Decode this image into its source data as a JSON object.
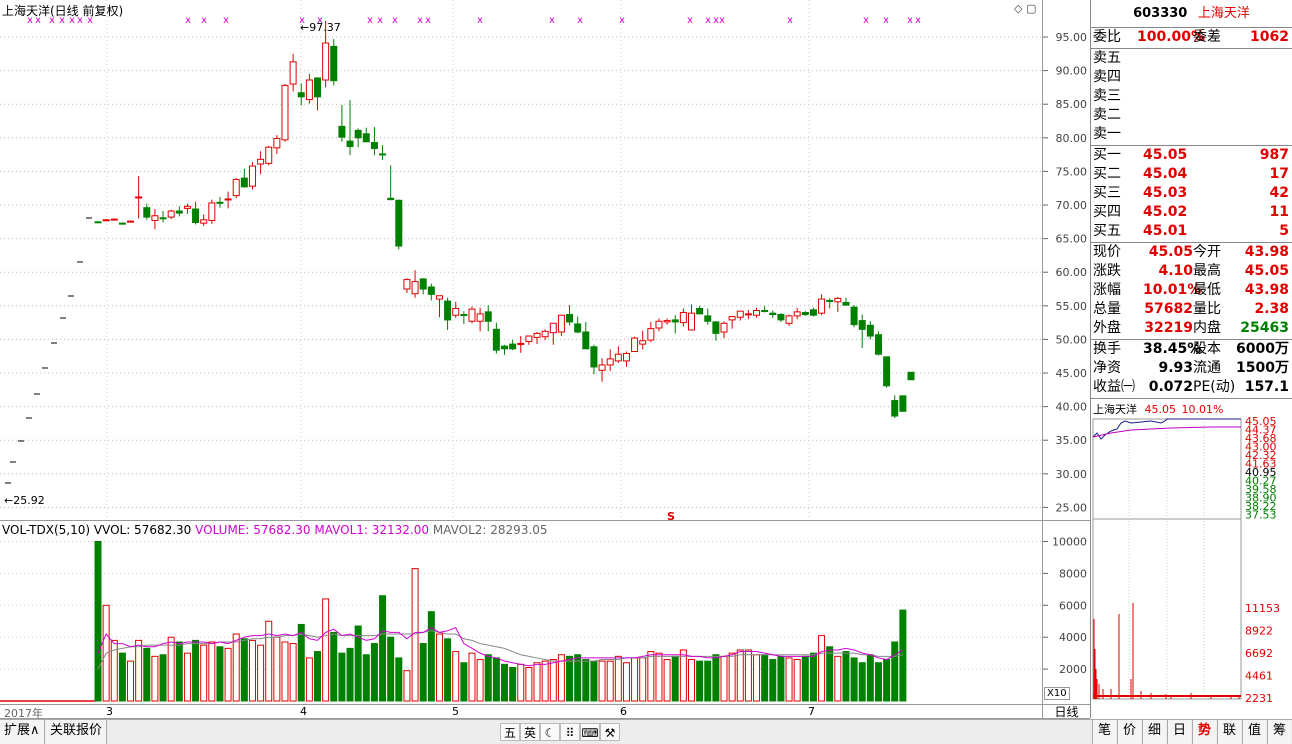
{
  "kline": {
    "title": "上海天洋(日线 前复权)",
    "high_label": "97.37",
    "low_label": "25.92",
    "s_marker": "S",
    "y_ticks": [
      "95.00",
      "90.00",
      "85.00",
      "80.00",
      "75.00",
      "70.00",
      "65.00",
      "60.00",
      "55.00",
      "50.00",
      "45.00",
      "40.00",
      "35.00",
      "30.00",
      "25.00"
    ],
    "y_values": [
      95,
      90,
      85,
      80,
      75,
      70,
      65,
      60,
      55,
      50,
      45,
      40,
      35,
      30,
      25
    ],
    "candles": [
      [
        67.5,
        67.6,
        67.3,
        67.4
      ],
      [
        67.8,
        67.9,
        67.7,
        67.8
      ],
      [
        67.9,
        68.0,
        67.8,
        67.9
      ],
      [
        67.3,
        67.4,
        67.1,
        67.2
      ],
      [
        67.6,
        67.7,
        67.5,
        67.6
      ],
      [
        71.2,
        74.3,
        68.0,
        71.2
      ],
      [
        69.6,
        70.2,
        67.8,
        68.2
      ],
      [
        67.7,
        69.4,
        66.4,
        68.4
      ],
      [
        68.1,
        69.1,
        67.4,
        68.0
      ],
      [
        68.2,
        69.3,
        67.9,
        69.1
      ],
      [
        69.1,
        69.8,
        68.3,
        68.8
      ],
      [
        69.5,
        70.2,
        68.7,
        69.8
      ],
      [
        69.4,
        70.5,
        67.1,
        67.4
      ],
      [
        67.3,
        68.6,
        66.9,
        67.8
      ],
      [
        67.7,
        70.8,
        67.2,
        70.3
      ],
      [
        70.4,
        71.2,
        69.6,
        70.3
      ],
      [
        70.8,
        72.0,
        69.5,
        70.9
      ],
      [
        71.4,
        74.0,
        71.0,
        73.8
      ],
      [
        74.0,
        75.4,
        72.6,
        72.7
      ],
      [
        72.8,
        76.4,
        72.3,
        75.8
      ],
      [
        76.1,
        78.0,
        74.6,
        76.8
      ],
      [
        76.2,
        78.8,
        75.9,
        78.6
      ],
      [
        78.5,
        80.4,
        77.6,
        79.9
      ],
      [
        79.7,
        88.0,
        79.4,
        87.8
      ],
      [
        88.0,
        92.5,
        86.9,
        91.3
      ],
      [
        86.7,
        88.1,
        84.8,
        86.1
      ],
      [
        85.7,
        89.5,
        85.1,
        88.6
      ],
      [
        88.9,
        89.0,
        84.1,
        86.1
      ],
      [
        88.6,
        97.4,
        87.5,
        94.1
      ],
      [
        93.6,
        94.7,
        87.8,
        88.5
      ],
      [
        81.7,
        84.9,
        79.4,
        80.1
      ],
      [
        79.5,
        85.6,
        77.4,
        78.7
      ],
      [
        81.1,
        81.4,
        78.6,
        80.0
      ],
      [
        80.6,
        81.5,
        79.4,
        79.4
      ],
      [
        79.3,
        81.6,
        77.4,
        78.4
      ],
      [
        77.6,
        78.9,
        76.7,
        77.5
      ],
      [
        71.0,
        75.9,
        70.7,
        70.8
      ],
      [
        70.7,
        70.8,
        63.4,
        63.9
      ],
      [
        57.5,
        59.1,
        56.9,
        58.9
      ],
      [
        56.8,
        60.3,
        56.2,
        58.6
      ],
      [
        59.0,
        59.1,
        56.7,
        57.5
      ],
      [
        57.8,
        58.3,
        55.8,
        56.7
      ],
      [
        56.0,
        56.5,
        53.3,
        56.5
      ],
      [
        55.7,
        56.2,
        51.4,
        52.9
      ],
      [
        53.6,
        55.6,
        53.2,
        54.6
      ],
      [
        53.7,
        54.2,
        52.3,
        53.6
      ],
      [
        52.7,
        54.9,
        52.4,
        54.5
      ],
      [
        52.7,
        54.7,
        51.2,
        53.8
      ],
      [
        54.1,
        55.1,
        51.2,
        52.7
      ],
      [
        51.5,
        52.5,
        47.9,
        48.4
      ],
      [
        49.0,
        49.2,
        47.7,
        48.6
      ],
      [
        49.3,
        49.9,
        48.4,
        48.6
      ],
      [
        49.3,
        50.5,
        48.0,
        49.4
      ],
      [
        49.7,
        50.6,
        49.2,
        50.5
      ],
      [
        50.3,
        51.1,
        49.3,
        50.9
      ],
      [
        50.4,
        51.5,
        49.9,
        51.2
      ],
      [
        51.0,
        51.4,
        49.2,
        52.4
      ],
      [
        51.1,
        53.6,
        50.5,
        53.6
      ],
      [
        53.7,
        55.1,
        52.1,
        52.6
      ],
      [
        52.3,
        53.4,
        50.9,
        51.1
      ],
      [
        51.1,
        52.6,
        48.6,
        48.6
      ],
      [
        48.9,
        49.2,
        44.8,
        45.9
      ],
      [
        45.4,
        47.2,
        43.7,
        46.2
      ],
      [
        46.2,
        48.5,
        45.3,
        47.1
      ],
      [
        46.8,
        49.0,
        46.5,
        47.8
      ],
      [
        46.8,
        48.2,
        45.9,
        47.9
      ],
      [
        48.2,
        50.4,
        48.1,
        50.2
      ],
      [
        49.3,
        51.3,
        48.5,
        49.8
      ],
      [
        49.9,
        52.6,
        49.6,
        51.6
      ],
      [
        51.7,
        53.1,
        51.2,
        52.7
      ],
      [
        52.6,
        53.1,
        52.2,
        52.8
      ],
      [
        52.9,
        53.6,
        50.9,
        52.6
      ],
      [
        52.5,
        54.6,
        51.9,
        54.0
      ],
      [
        51.4,
        55.2,
        51.4,
        53.9
      ],
      [
        54.6,
        55.0,
        53.8,
        53.8
      ],
      [
        53.5,
        54.6,
        52.2,
        52.7
      ],
      [
        52.6,
        52.7,
        49.8,
        50.9
      ],
      [
        51.1,
        52.7,
        50.2,
        52.4
      ],
      [
        52.9,
        53.5,
        51.6,
        53.4
      ],
      [
        53.3,
        54.3,
        52.8,
        54.2
      ],
      [
        53.7,
        54.4,
        53.0,
        53.8
      ],
      [
        53.6,
        54.7,
        53.2,
        54.3
      ],
      [
        54.3,
        55.0,
        54.0,
        54.2
      ],
      [
        53.9,
        54.3,
        53.2,
        53.7
      ],
      [
        53.7,
        53.9,
        52.6,
        52.9
      ],
      [
        52.4,
        53.7,
        52.0,
        53.5
      ],
      [
        53.5,
        54.7,
        53.0,
        54.1
      ],
      [
        54.0,
        54.2,
        53.5,
        53.7
      ],
      [
        54.4,
        54.7,
        53.4,
        53.6
      ],
      [
        53.9,
        56.7,
        53.6,
        56.0
      ],
      [
        55.8,
        56.1,
        54.6,
        55.7
      ],
      [
        55.6,
        56.3,
        54.1,
        56.1
      ],
      [
        55.5,
        56.2,
        55.0,
        55.1
      ],
      [
        54.8,
        55.1,
        51.8,
        52.2
      ],
      [
        52.8,
        53.7,
        48.7,
        51.5
      ],
      [
        52.1,
        52.7,
        50.0,
        50.5
      ],
      [
        50.7,
        51.2,
        47.6,
        47.8
      ],
      [
        47.4,
        47.4,
        42.8,
        43.1
      ],
      [
        40.9,
        41.7,
        38.3,
        38.6
      ],
      [
        41.6,
        41.6,
        39.3,
        39.3
      ],
      [
        45.1,
        45.1,
        44.0,
        44.0
      ]
    ],
    "limit_marks": [
      "x",
      "x",
      "x",
      "x",
      "x",
      "x",
      "x",
      "x",
      "x",
      "x",
      "x",
      "x",
      "x",
      "x",
      "x",
      "x",
      "x",
      "x",
      "x",
      "x",
      "x",
      "x",
      "x",
      "x",
      "x",
      "x",
      "x",
      "x"
    ]
  },
  "volume": {
    "title": "VOL-TDX(5,10)",
    "vol_label": "VVOL: 57682.30",
    "volume_label": "VOLUME: 57682.30",
    "mavol1_label": "MAVOL1: 32132.00",
    "mavol2_label": "MAVOL2: 28293.05",
    "y_ticks": [
      "10000",
      "8000",
      "6000",
      "4000",
      "2000"
    ],
    "y_values": [
      10000,
      8000,
      6000,
      4000,
      2000
    ],
    "scale_mark": "X10",
    "bars": [
      10000,
      6000,
      3800,
      3000,
      2500,
      3800,
      3300,
      2800,
      2900,
      4000,
      3700,
      3000,
      3800,
      3500,
      3700,
      3400,
      3300,
      4200,
      3900,
      3800,
      3500,
      5000,
      4000,
      3700,
      3600,
      4800,
      2700,
      3100,
      6400,
      4300,
      3000,
      3300,
      4700,
      2900,
      3600,
      6600,
      4000,
      2700,
      1900,
      8300,
      3600,
      5600,
      4200,
      3900,
      3100,
      2400,
      3000,
      2600,
      2900,
      2700,
      2300,
      2100,
      2300,
      2100,
      2400,
      2500,
      2600,
      2900,
      2800,
      2900,
      2600,
      2500,
      2500,
      2500,
      2800,
      2400,
      2700,
      2700,
      3100,
      3000,
      2600,
      2800,
      3200,
      2600,
      2500,
      2500,
      2900,
      2800,
      3000,
      3200,
      3200,
      2900,
      2900,
      2600,
      2800,
      2700,
      2600,
      2800,
      3000,
      4100,
      3400,
      2800,
      3100,
      2700,
      2400,
      2900,
      2400,
      2600,
      3700,
      5700
    ],
    "mavol1": [
      3000,
      4200,
      3600,
      3600,
      3400,
      3500,
      3400,
      3400,
      3600,
      3700,
      3600,
      3700,
      3700,
      3700,
      3600,
      3700,
      3600,
      3800,
      4000,
      4100,
      4100,
      4200,
      4100,
      4200,
      4100,
      4300,
      3900,
      3800,
      4300,
      4500,
      4100,
      4200,
      4000,
      3800,
      3900,
      4400,
      4300,
      4300,
      3900,
      4300,
      4300,
      4600,
      4300,
      4400,
      4600,
      3600,
      3300,
      3000,
      2800,
      2700,
      2500,
      2400,
      2300,
      2200,
      2300,
      2300,
      2400,
      2500,
      2600,
      2700,
      2700,
      2700,
      2700,
      2700,
      2700,
      2700,
      2700,
      2800,
      2900,
      2900,
      2900,
      2900,
      2900,
      2800,
      2800,
      2700,
      2700,
      2800,
      2900,
      3100,
      3100,
      3100,
      3000,
      2900,
      2800,
      2800,
      2800,
      2800,
      2800,
      3100,
      3200,
      3200,
      3300,
      3200,
      3000,
      2900,
      2700,
      2600,
      2900,
      3200
    ],
    "mavol2": [
      2000,
      3000,
      3200,
      3300,
      3400,
      3400,
      3500,
      3500,
      3500,
      3500,
      3500,
      3600,
      3600,
      3600,
      3600,
      3700,
      3700,
      3700,
      3800,
      3900,
      3900,
      4000,
      4000,
      4100,
      4100,
      4200,
      4100,
      4000,
      4100,
      4200,
      4100,
      4100,
      4100,
      4100,
      4100,
      4200,
      4200,
      4200,
      4200,
      4200,
      4300,
      4400,
      4300,
      4200,
      4200,
      3900,
      3800,
      3600,
      3500,
      3400,
      3300,
      3100,
      2900,
      2800,
      2700,
      2600,
      2500,
      2500,
      2500,
      2500,
      2500,
      2500,
      2600,
      2600,
      2600,
      2700,
      2700,
      2700,
      2800,
      2800,
      2800,
      2800,
      2800,
      2800,
      2800,
      2800,
      2800,
      2800,
      2800,
      2900,
      2900,
      2900,
      2900,
      2900,
      2900,
      2900,
      2900,
      2900,
      2900,
      3000,
      3000,
      3000,
      3000,
      3000,
      2900,
      2900,
      2800,
      2800,
      2800,
      2900
    ]
  },
  "xaxis": {
    "labels": [
      "2017年",
      "3",
      "4",
      "5",
      "6",
      "7"
    ],
    "right_label": "日线"
  },
  "quote": {
    "code": "603330",
    "name": "上海天洋",
    "weibi_label": "委比",
    "weibi_value": "100.00%",
    "weicha_label": "委差",
    "weicha_value": "1062",
    "sell": [
      {
        "label": "卖五"
      },
      {
        "label": "卖四"
      },
      {
        "label": "卖三"
      },
      {
        "label": "卖二"
      },
      {
        "label": "卖一"
      }
    ],
    "buy": [
      {
        "label": "买一",
        "price": "45.05",
        "vol": "987"
      },
      {
        "label": "买二",
        "price": "45.04",
        "vol": "17"
      },
      {
        "label": "买三",
        "price": "45.03",
        "vol": "42"
      },
      {
        "label": "买四",
        "price": "45.02",
        "vol": "11"
      },
      {
        "label": "买五",
        "price": "45.01",
        "vol": "5"
      }
    ],
    "stats1": [
      {
        "l1": "现价",
        "v1": "45.05",
        "l2": "今开",
        "v2": "43.98"
      },
      {
        "l1": "涨跌",
        "v1": "4.10",
        "l2": "最高",
        "v2": "45.05"
      },
      {
        "l1": "涨幅",
        "v1": "10.01%",
        "l2": "最低",
        "v2": "43.98"
      },
      {
        "l1": "总量",
        "v1": "57682",
        "l2": "量比",
        "v2": "2.38"
      },
      {
        "l1": "外盘",
        "v1": "32219",
        "l2": "内盘",
        "v2": "25463"
      }
    ],
    "stats2": [
      {
        "l1": "换手",
        "v1": "38.45%",
        "l2": "股本",
        "v2": "6000万"
      },
      {
        "l1": "净资",
        "v1": "9.93",
        "l2": "流通",
        "v2": "1500万"
      },
      {
        "l1": "收益㈠",
        "v1": "0.072",
        "l2": "PE(动)",
        "v2": "157.1"
      }
    ]
  },
  "mini": {
    "name": "上海天洋",
    "price": "45.05",
    "pct": "10.01%",
    "price_ticks": [
      "45.05",
      "44.37",
      "43.68",
      "43.00",
      "42.32",
      "41.63",
      "40.95",
      "40.27",
      "39.58",
      "38.90",
      "38.22",
      "37.53"
    ],
    "vol_ticks": [
      "11153",
      "8922",
      "6692",
      "4461",
      "2231"
    ]
  },
  "bottom": {
    "tab1": "扩展∧",
    "tab2": "关联报价",
    "tools": [
      "五",
      "英",
      "☾",
      "⠿",
      "⌨",
      "⚒"
    ],
    "right_tabs": [
      "笔",
      "价",
      "细",
      "日",
      "势",
      "联",
      "值",
      "筹"
    ]
  }
}
